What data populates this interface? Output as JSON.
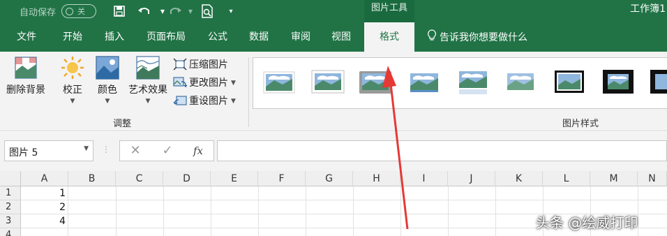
{
  "titlebar": {
    "autosave_label": "自动保存",
    "autosave_state": "关",
    "picture_tools": "图片工具",
    "doc_title": "工作簿1"
  },
  "tabs": [
    "文件",
    "开始",
    "插入",
    "页面布局",
    "公式",
    "数据",
    "审阅",
    "视图",
    "格式"
  ],
  "active_tab": "格式",
  "tell_me": "告诉我你想要做什么",
  "ribbon": {
    "remove_bg": "删除背景",
    "corrections": "校正",
    "color": "颜色",
    "artistic": "艺术效果",
    "compress": "压缩图片",
    "change": "更改图片",
    "reset": "重设图片",
    "adjust_group": "调整",
    "styles_group": "图片样式"
  },
  "formula_bar": {
    "name_box": "图片 5",
    "fx": "fx",
    "content": ""
  },
  "grid": {
    "columns": [
      "A",
      "B",
      "C",
      "D",
      "E",
      "F",
      "G",
      "H",
      "I",
      "J",
      "K",
      "L",
      "M",
      "N"
    ],
    "rows": [
      "1",
      "2",
      "3",
      "4"
    ],
    "cells_A": [
      "1",
      "2",
      "4",
      ""
    ]
  },
  "watermark": "头条 @绘威打印",
  "colors": {
    "excel_green": "#217346",
    "ribbon_bg": "#f3f3f3",
    "arrow_red": "#e53935"
  }
}
